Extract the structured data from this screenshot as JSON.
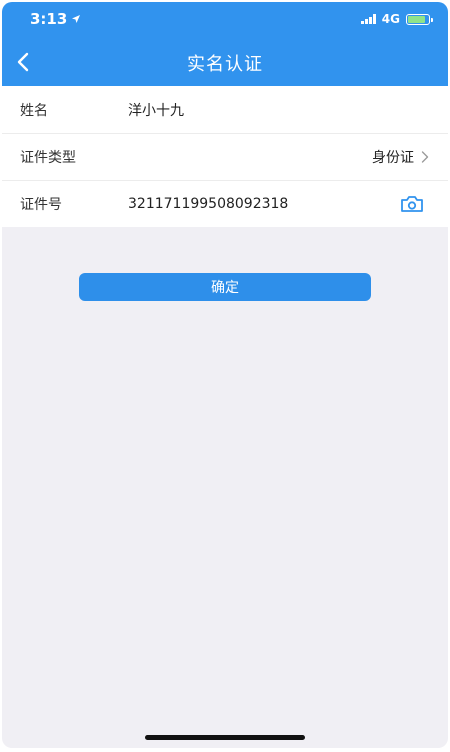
{
  "status_bar": {
    "time": "3:13",
    "network": "4G"
  },
  "nav": {
    "title": "实名认证"
  },
  "form": {
    "name": {
      "label": "姓名",
      "value": "洋小十九"
    },
    "id_type": {
      "label": "证件类型",
      "value": "身份证"
    },
    "id_number": {
      "label": "证件号",
      "value": "321171199508092318"
    }
  },
  "confirm": {
    "label": "确定"
  },
  "colors": {
    "primary": "#3193ee",
    "page_background": "#f0eff4"
  }
}
